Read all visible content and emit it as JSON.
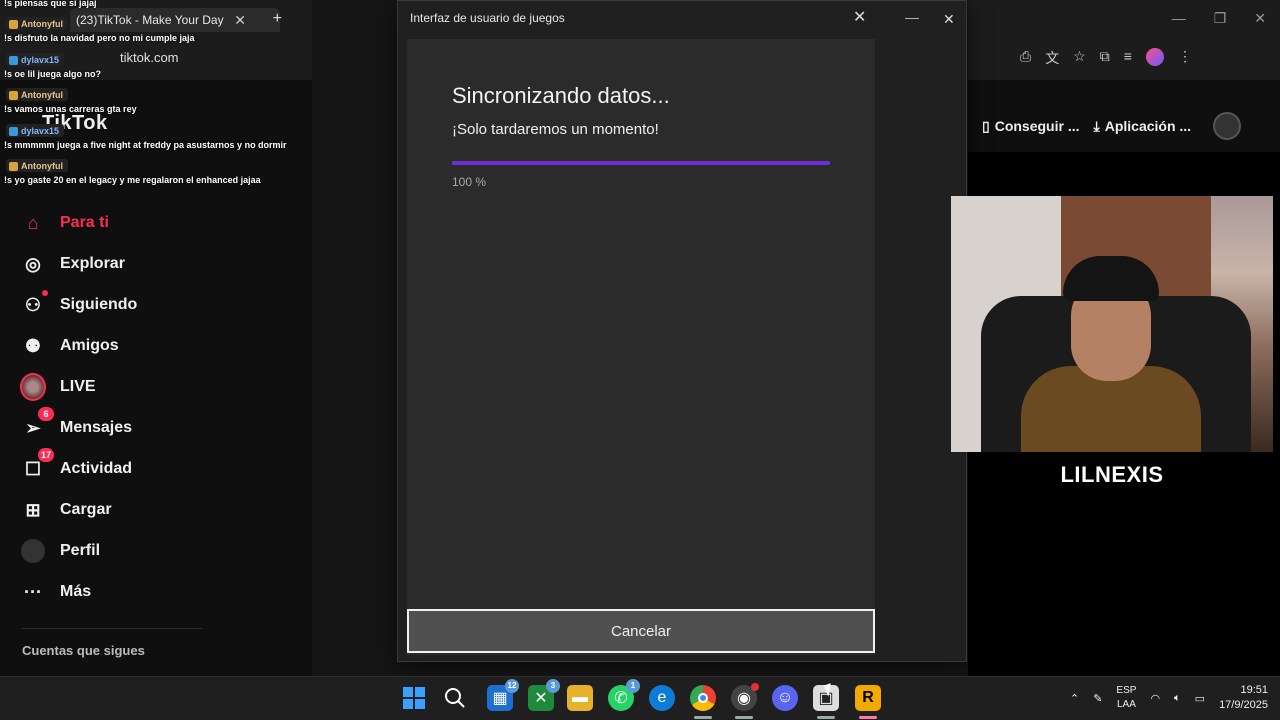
{
  "browser": {
    "tab_title": "(23)TikTok - Make Your Day",
    "url": "tiktok.com"
  },
  "chat": {
    "messages": [
      {
        "user": "",
        "text": "!s piensas que si jajaj"
      },
      {
        "user": "Antonyful",
        "text": "!s disfruto la navidad pero no mi cumple jaja"
      },
      {
        "user": "dylavx15",
        "text": "!s oe lil juega algo no?"
      },
      {
        "user": "Antonyful",
        "text": "!s vamos unas carreras gta rey"
      },
      {
        "user": "dylavx15",
        "text": "!s mmmmm juega a five night at freddy pa asustarnos y no dormir"
      },
      {
        "user": "Antonyful",
        "text": "!s yo gaste 20 en el legacy y me regalaron el enhanced jajaa"
      }
    ]
  },
  "tiktok": {
    "logo": "TikTok",
    "header": {
      "get_coins": "Conseguir ...",
      "app": "Aplicación ..."
    },
    "nav": [
      {
        "label": "Para ti",
        "icon": "home-icon",
        "active": true
      },
      {
        "label": "Explorar",
        "icon": "compass-icon"
      },
      {
        "label": "Siguiendo",
        "icon": "following-icon",
        "dot": true
      },
      {
        "label": "Amigos",
        "icon": "friends-icon"
      },
      {
        "label": "LIVE",
        "icon": "live-icon"
      },
      {
        "label": "Mensajes",
        "icon": "messages-icon",
        "badge": "6"
      },
      {
        "label": "Actividad",
        "icon": "activity-icon",
        "badge": "17"
      },
      {
        "label": "Cargar",
        "icon": "upload-icon"
      },
      {
        "label": "Perfil",
        "icon": "profile-icon"
      },
      {
        "label": "Más",
        "icon": "more-icon"
      }
    ],
    "following_title": "Cuentas que sigues"
  },
  "dialog": {
    "window_title": "Interfaz de usuario de juegos",
    "heading": "Sincronizando datos...",
    "subtitle": "¡Solo tardaremos un momento!",
    "progress_value": 100,
    "progress_label": "100 %",
    "cancel_label": "Cancelar",
    "accent_color": "#6c2ed6"
  },
  "stream": {
    "streamer_name": "LILNEXIS"
  },
  "taskbar": {
    "widgets_badge": "12",
    "xbox_badge": "3",
    "whatsapp_badge": "1",
    "language": "ESP",
    "layout": "LAA",
    "time": "19:51",
    "date": "17/9/2025"
  }
}
